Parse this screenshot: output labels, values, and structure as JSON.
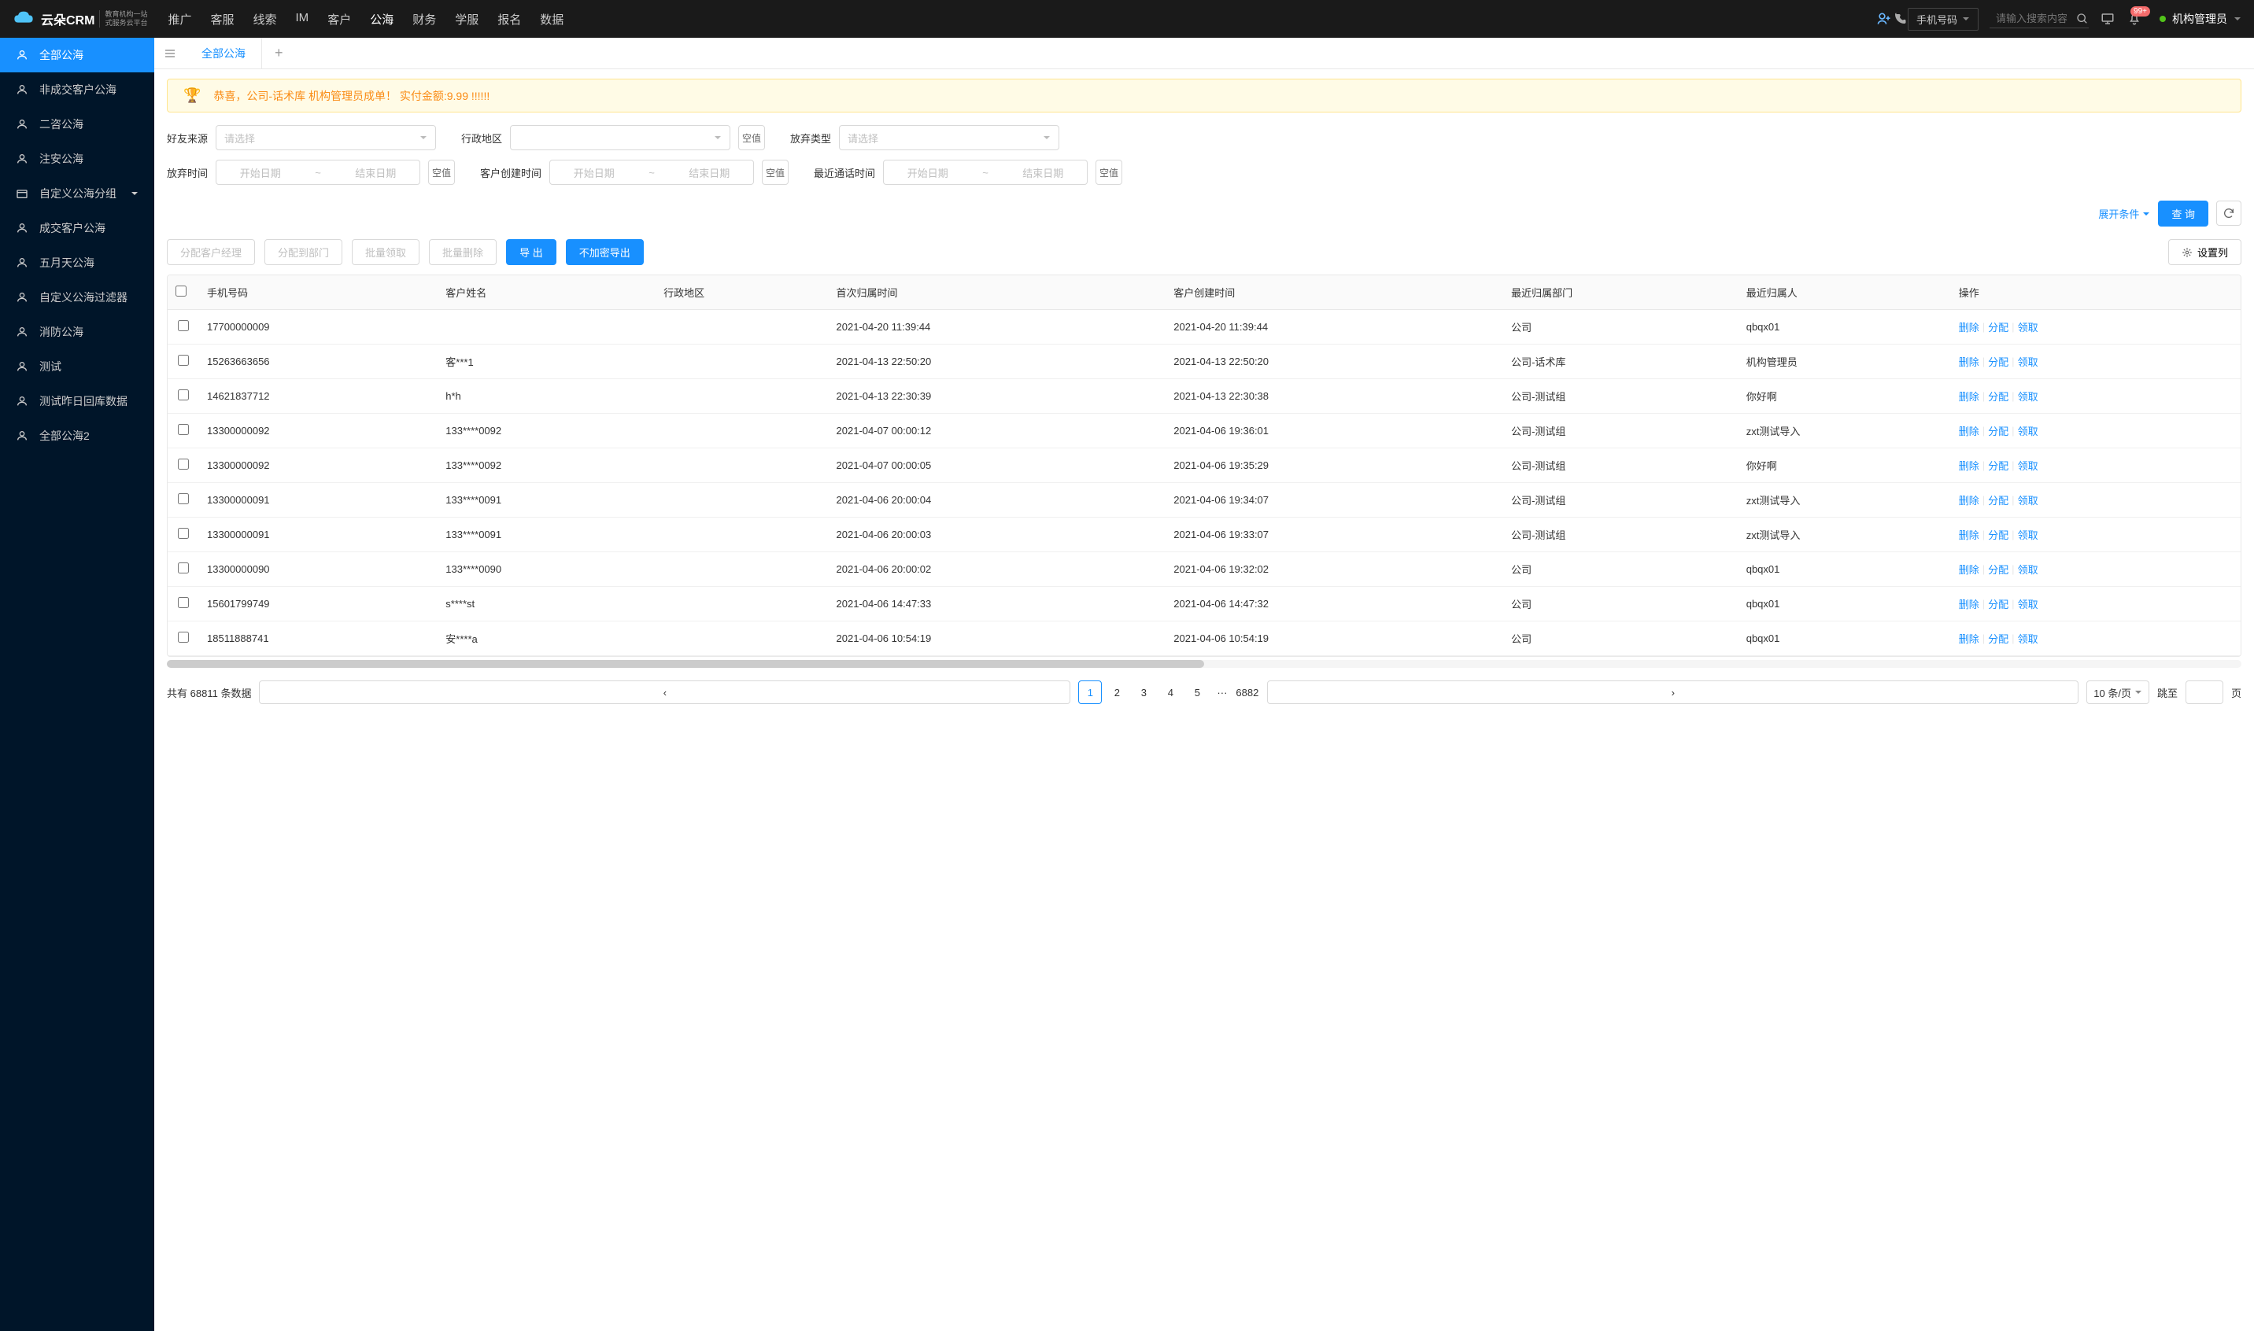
{
  "logo": {
    "brand": "云朵CRM",
    "tagline": "教育机构一站\n式服务云平台",
    "url": "www.yunduocrm.com"
  },
  "nav": [
    {
      "label": "推广"
    },
    {
      "label": "客服"
    },
    {
      "label": "线索"
    },
    {
      "label": "IM"
    },
    {
      "label": "客户"
    },
    {
      "label": "公海",
      "active": true
    },
    {
      "label": "财务"
    },
    {
      "label": "学服"
    },
    {
      "label": "报名"
    },
    {
      "label": "数据"
    }
  ],
  "header": {
    "search_type": "手机号码",
    "search_placeholder": "请输入搜索内容",
    "notification_count": "99+",
    "user_name": "机构管理员"
  },
  "sidebar": [
    {
      "label": "全部公海",
      "icon": "user",
      "active": true
    },
    {
      "label": "非成交客户公海",
      "icon": "user"
    },
    {
      "label": "二咨公海",
      "icon": "user"
    },
    {
      "label": "注安公海",
      "icon": "user"
    },
    {
      "label": "自定义公海分组",
      "icon": "folder",
      "expandable": true
    },
    {
      "label": "成交客户公海",
      "icon": "user"
    },
    {
      "label": "五月天公海",
      "icon": "user"
    },
    {
      "label": "自定义公海过滤器",
      "icon": "user"
    },
    {
      "label": "消防公海",
      "icon": "user"
    },
    {
      "label": "测试",
      "icon": "user"
    },
    {
      "label": "测试昨日回库数据",
      "icon": "user"
    },
    {
      "label": "全部公海2",
      "icon": "user"
    }
  ],
  "tabs": {
    "active": "全部公海"
  },
  "alert": "恭喜，公司-话术库   机构管理员成单！   实付金额:9.99 !!!!!!",
  "filters": {
    "row1": [
      {
        "label": "好友来源",
        "placeholder": "请选择",
        "type": "select"
      },
      {
        "label": "行政地区",
        "placeholder": "",
        "type": "select",
        "null_btn": "空值"
      },
      {
        "label": "放弃类型",
        "placeholder": "请选择",
        "type": "select"
      }
    ],
    "row2": [
      {
        "label": "放弃时间",
        "start": "开始日期",
        "end": "结束日期",
        "null_btn": "空值"
      },
      {
        "label": "客户创建时间",
        "start": "开始日期",
        "end": "结束日期",
        "null_btn": "空值"
      },
      {
        "label": "最近通话时间",
        "start": "开始日期",
        "end": "结束日期",
        "null_btn": "空值"
      }
    ],
    "expand": "展开条件",
    "search": "查 询"
  },
  "toolbar": {
    "assign_manager": "分配客户经理",
    "assign_dept": "分配到部门",
    "batch_claim": "批量领取",
    "batch_delete": "批量删除",
    "export": "导 出",
    "export_plain": "不加密导出",
    "columns": "设置列"
  },
  "table": {
    "headers": [
      "手机号码",
      "客户姓名",
      "行政地区",
      "首次归属时间",
      "客户创建时间",
      "最近归属部门",
      "最近归属人",
      "操作"
    ],
    "actions": [
      "删除",
      "分配",
      "领取"
    ],
    "rows": [
      {
        "phone": "17700000009",
        "name": "",
        "region": "",
        "first_time": "2021-04-20 11:39:44",
        "create_time": "2021-04-20 11:39:44",
        "dept": "公司",
        "person": "qbqx01"
      },
      {
        "phone": "15263663656",
        "name": "客***1",
        "region": "",
        "first_time": "2021-04-13 22:50:20",
        "create_time": "2021-04-13 22:50:20",
        "dept": "公司-话术库",
        "person": "机构管理员"
      },
      {
        "phone": "14621837712",
        "name": "h*h",
        "region": "",
        "first_time": "2021-04-13 22:30:39",
        "create_time": "2021-04-13 22:30:38",
        "dept": "公司-测试组",
        "person": "你好啊"
      },
      {
        "phone": "13300000092",
        "name": "133****0092",
        "region": "",
        "first_time": "2021-04-07 00:00:12",
        "create_time": "2021-04-06 19:36:01",
        "dept": "公司-测试组",
        "person": "zxt测试导入"
      },
      {
        "phone": "13300000092",
        "name": "133****0092",
        "region": "",
        "first_time": "2021-04-07 00:00:05",
        "create_time": "2021-04-06 19:35:29",
        "dept": "公司-测试组",
        "person": "你好啊"
      },
      {
        "phone": "13300000091",
        "name": "133****0091",
        "region": "",
        "first_time": "2021-04-06 20:00:04",
        "create_time": "2021-04-06 19:34:07",
        "dept": "公司-测试组",
        "person": "zxt测试导入"
      },
      {
        "phone": "13300000091",
        "name": "133****0091",
        "region": "",
        "first_time": "2021-04-06 20:00:03",
        "create_time": "2021-04-06 19:33:07",
        "dept": "公司-测试组",
        "person": "zxt测试导入"
      },
      {
        "phone": "13300000090",
        "name": "133****0090",
        "region": "",
        "first_time": "2021-04-06 20:00:02",
        "create_time": "2021-04-06 19:32:02",
        "dept": "公司",
        "person": "qbqx01"
      },
      {
        "phone": "15601799749",
        "name": "s****st",
        "region": "",
        "first_time": "2021-04-06 14:47:33",
        "create_time": "2021-04-06 14:47:32",
        "dept": "公司",
        "person": "qbqx01"
      },
      {
        "phone": "18511888741",
        "name": "安****a",
        "region": "",
        "first_time": "2021-04-06 10:54:19",
        "create_time": "2021-04-06 10:54:19",
        "dept": "公司",
        "person": "qbqx01"
      }
    ]
  },
  "pagination": {
    "total_prefix": "共有",
    "total": "68811",
    "total_suffix": "条数据",
    "pages": [
      "1",
      "2",
      "3",
      "4",
      "5"
    ],
    "last": "6882",
    "size": "10 条/页",
    "jump_label": "跳至",
    "page_label": "页"
  }
}
